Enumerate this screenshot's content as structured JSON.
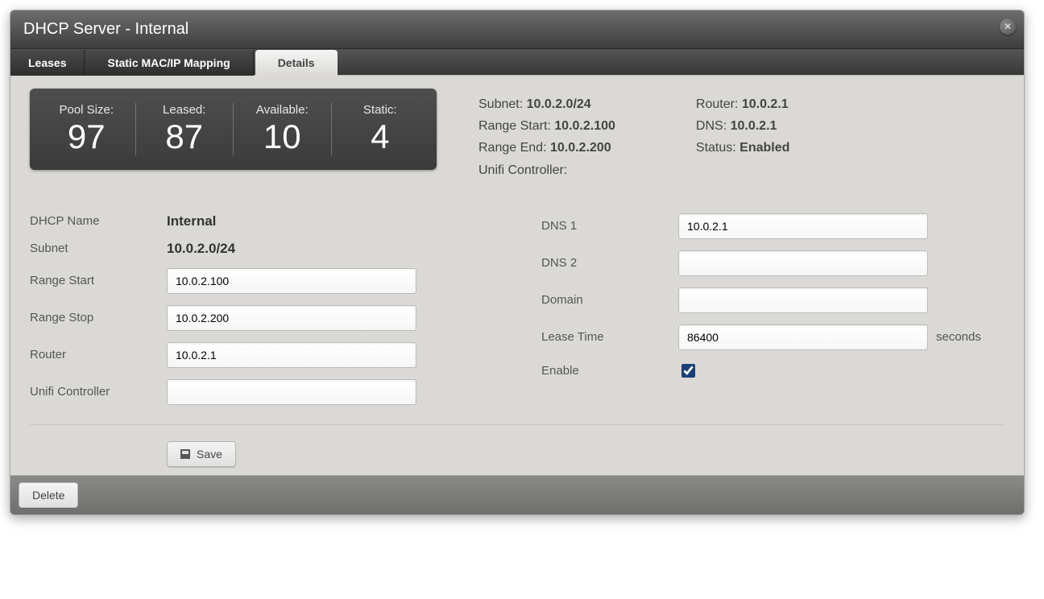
{
  "title": "DHCP Server - Internal",
  "tabs": {
    "leases": "Leases",
    "mapping": "Static MAC/IP Mapping",
    "details": "Details"
  },
  "stats": {
    "pool": {
      "label": "Pool Size:",
      "value": "97"
    },
    "leased": {
      "label": "Leased:",
      "value": "87"
    },
    "avail": {
      "label": "Available:",
      "value": "10"
    },
    "static": {
      "label": "Static:",
      "value": "4"
    }
  },
  "summary": {
    "subnet_label": "Subnet:",
    "subnet": "10.0.2.0/24",
    "rstart_label": "Range Start:",
    "rstart": "10.0.2.100",
    "rend_label": "Range End:",
    "rend": "10.0.2.200",
    "unifi_label": "Unifi Controller:",
    "unifi": "",
    "router_label": "Router:",
    "router": "10.0.2.1",
    "dns_label": "DNS:",
    "dns": "10.0.2.1",
    "status_label": "Status:",
    "status": "Enabled"
  },
  "form": {
    "dhcpname_label": "DHCP Name",
    "dhcpname": "Internal",
    "subnet_label": "Subnet",
    "subnet": "10.0.2.0/24",
    "rstart_label": "Range Start",
    "rstart": "10.0.2.100",
    "rstop_label": "Range Stop",
    "rstop": "10.0.2.200",
    "router_label": "Router",
    "router": "10.0.2.1",
    "unifi_label": "Unifi Controller",
    "unifi": "",
    "dns1_label": "DNS 1",
    "dns1": "10.0.2.1",
    "dns2_label": "DNS 2",
    "dns2": "",
    "domain_label": "Domain",
    "domain": "",
    "lease_label": "Lease Time",
    "lease": "86400",
    "lease_suffix": "seconds",
    "enable_label": "Enable"
  },
  "buttons": {
    "save": "Save",
    "delete": "Delete"
  }
}
